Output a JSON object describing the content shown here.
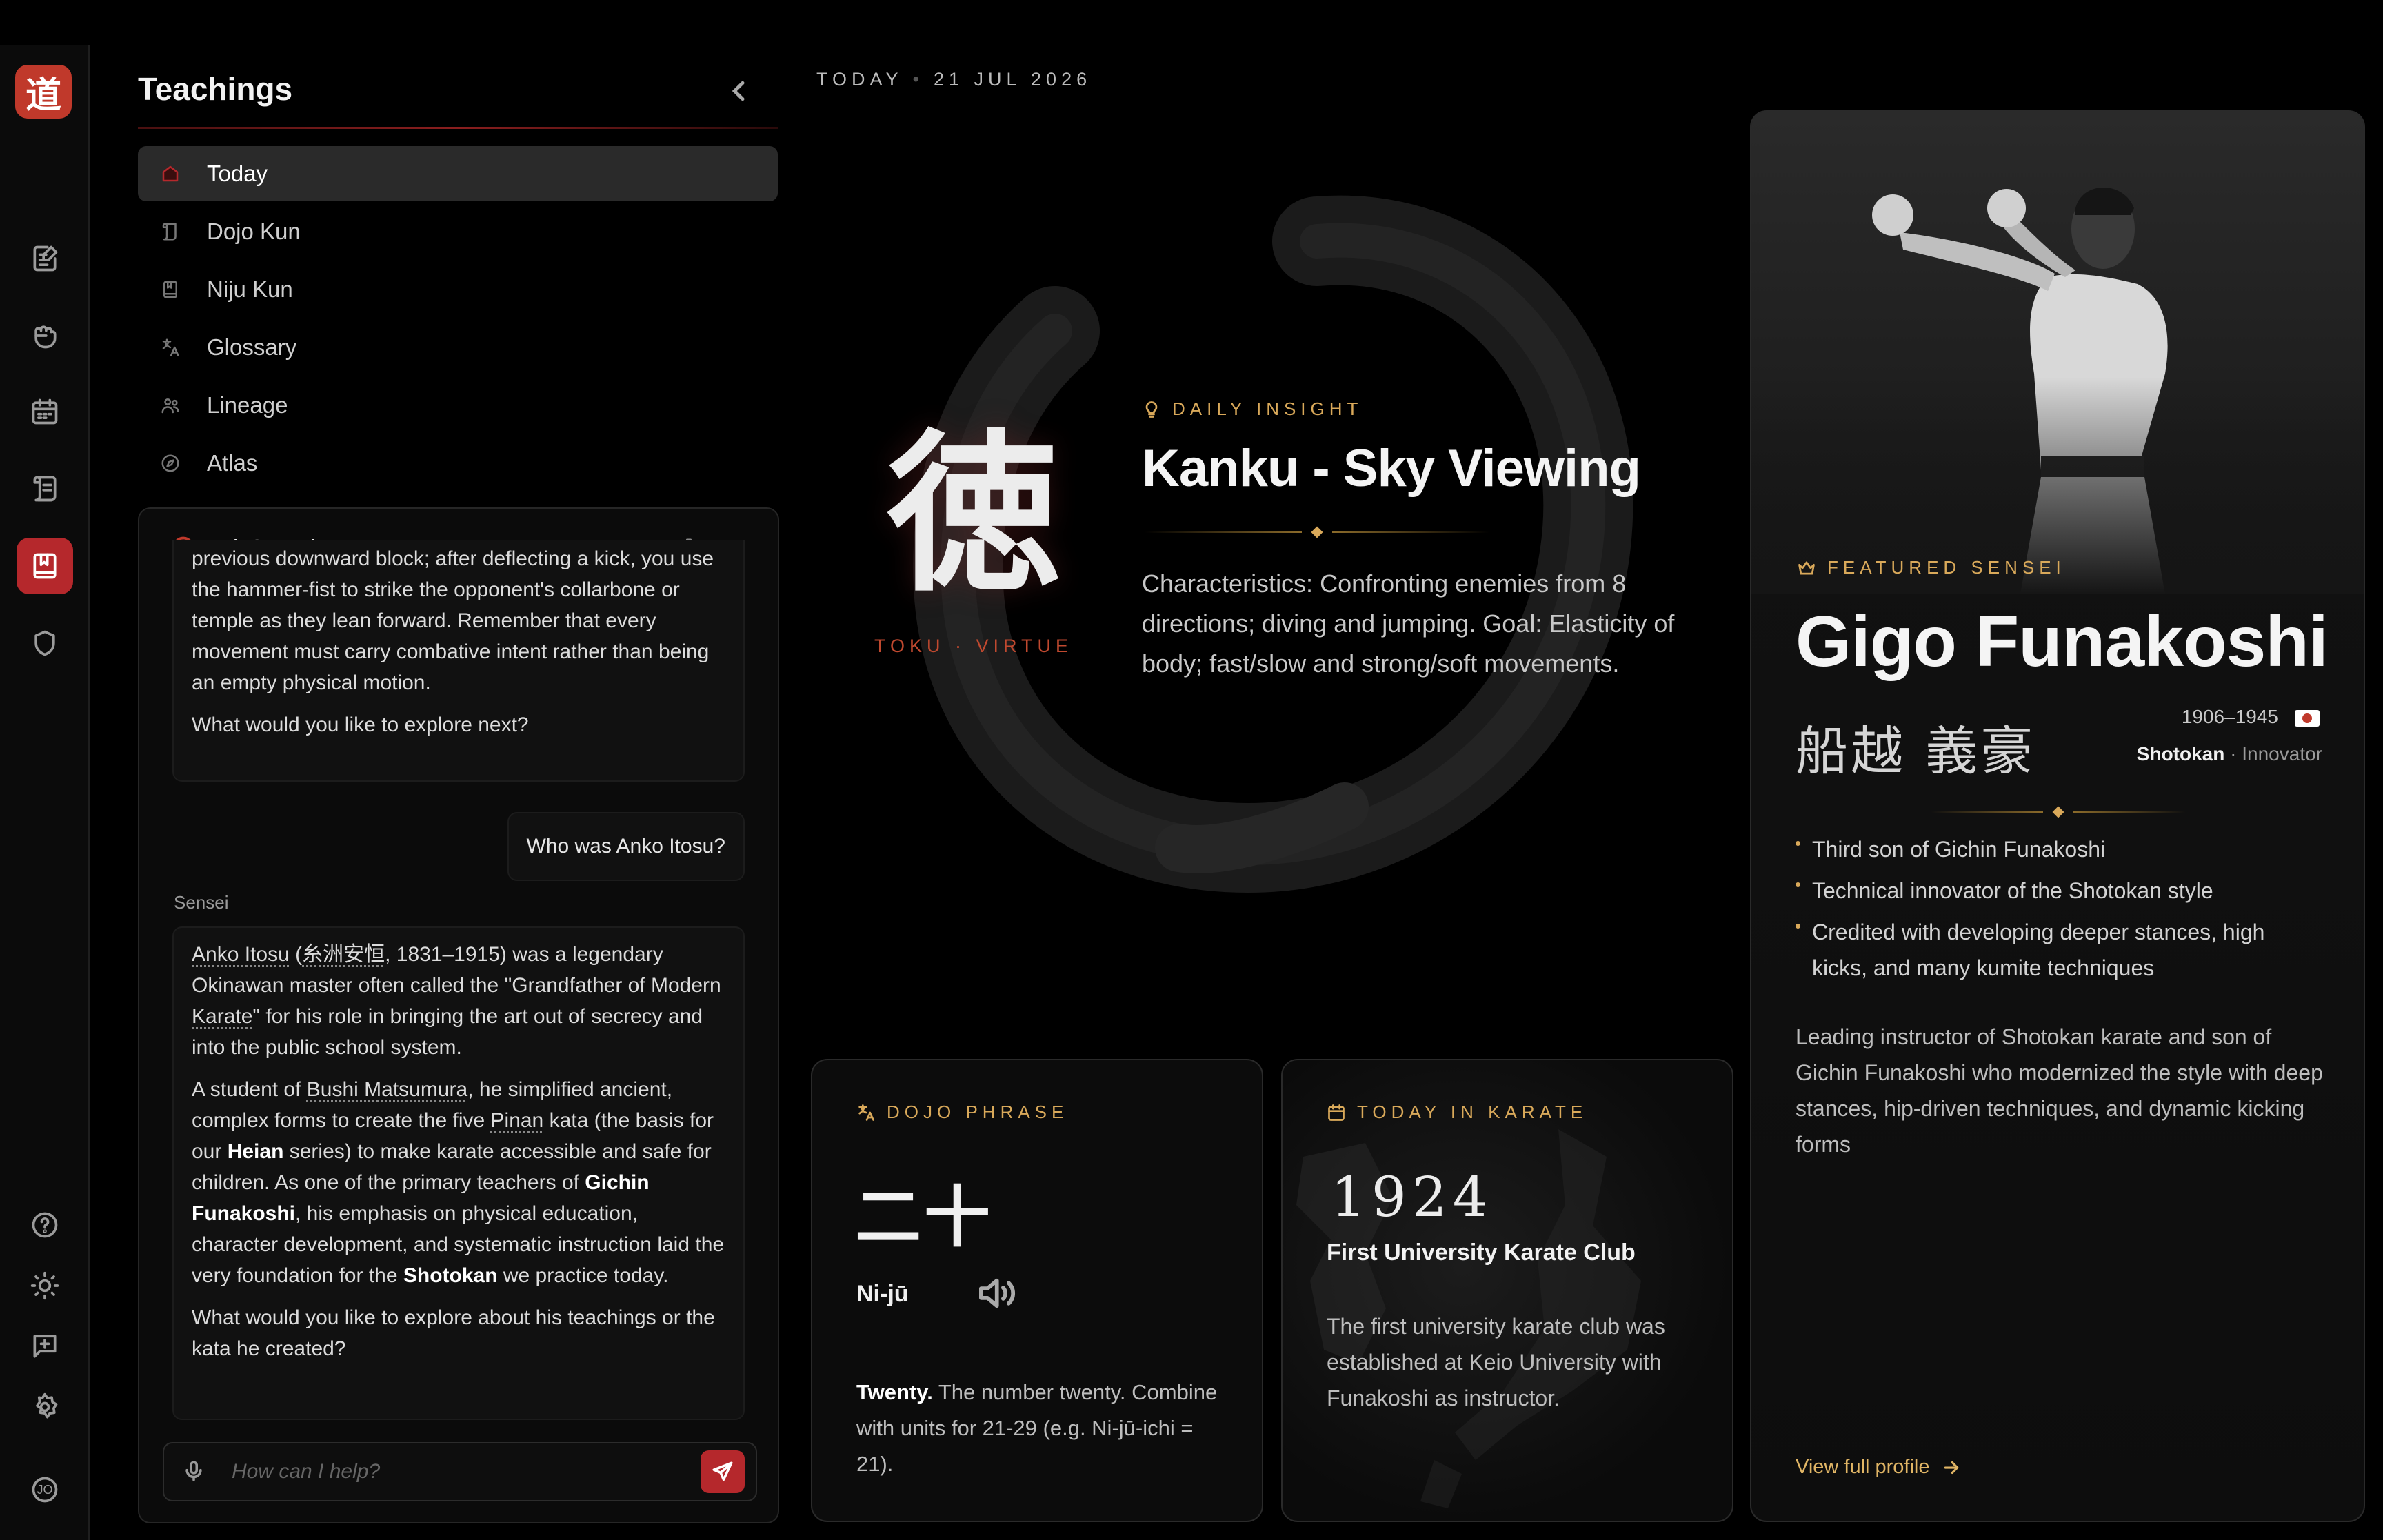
{
  "app": {
    "logo_glyph": "道",
    "accent": "#b5282c",
    "gold": "#d9a95a"
  },
  "rail": {
    "items": [
      {
        "icon": "edit-note-icon"
      },
      {
        "icon": "fist-icon"
      },
      {
        "icon": "calendar-icon"
      },
      {
        "icon": "scroll-icon"
      },
      {
        "icon": "book-icon",
        "active": true
      },
      {
        "icon": "shield-icon"
      }
    ],
    "bottom": [
      {
        "icon": "help-icon"
      },
      {
        "icon": "sun-icon"
      },
      {
        "icon": "feedback-icon"
      },
      {
        "icon": "settings-icon"
      }
    ],
    "avatar_initials": "JO"
  },
  "sidebar": {
    "title": "Teachings",
    "items": [
      {
        "label": "Today",
        "icon": "home-icon",
        "active": true
      },
      {
        "label": "Dojo Kun",
        "icon": "scroll-icon"
      },
      {
        "label": "Niju Kun",
        "icon": "book-icon"
      },
      {
        "label": "Glossary",
        "icon": "translate-icon"
      },
      {
        "label": "Lineage",
        "icon": "users-icon"
      },
      {
        "label": "Atlas",
        "icon": "compass-icon"
      }
    ]
  },
  "chat": {
    "title": "Ask Sensei",
    "prev_a": "previous downward block; after deflecting a kick, you use the hammer-fist to strike the opponent's collarbone or temple as they lean forward. Remember that every movement must carry combative intent rather than being an empty physical motion.",
    "prev_b": "What would you like to explore next?",
    "user_msg": "Who was Anko Itosu?",
    "sender": "Sensei",
    "r1_name": "Anko Itosu",
    "r1_kanji": "糸洲安恒",
    "r1_a": ", 1831–1915) was a legendary Okinawan master often called the \"Grandfather of Modern ",
    "r1_karate": "Karate",
    "r1_b": "\" for his role in bringing the art out of secrecy and into the public school system.",
    "r2_a": "A student of ",
    "r2_bushi": "Bushi Matsumura",
    "r2_b": ", he simplified ancient, complex forms to create the five ",
    "r2_pinan": "Pinan",
    "r2_c": " kata (the basis for our ",
    "r2_heian": "Heian",
    "r2_d": " series) to make karate accessible and safe for children. As one of the primary teachers of ",
    "r2_gichin": "Gichin Funakoshi",
    "r2_e": ", his emphasis on physical education, character development, and systematic instruction laid the very foundation for the ",
    "r2_shotokan": "Shotokan",
    "r2_f": " we practice today.",
    "r3": "What would you like to explore about his teachings or the kata he created?",
    "input_placeholder": "How can I help?"
  },
  "date": {
    "label": "TODAY",
    "value": "21 JUL 2026"
  },
  "hero": {
    "kanji": "徳",
    "kanji_sub": "TOKU · VIRTUE",
    "eyebrow": "DAILY INSIGHT",
    "title": "Kanku - Sky Viewing",
    "body": "Characteristics: Confronting enemies from 8 directions; diving and jumping. Goal: Elasticity of body; fast/slow and strong/soft movements."
  },
  "dojo_phrase": {
    "eyebrow": "DOJO PHRASE",
    "kanji": "二十",
    "romaji": "Ni-jū",
    "term": "Twenty.",
    "body": " The number twenty. Combine with units for 21-29 (e.g. Ni-jū-ichi = 21)."
  },
  "today_in_karate": {
    "eyebrow": "TODAY IN KARATE",
    "year": "1924",
    "title": "First University Karate Club",
    "body": "The first university karate club was established at Keio University with Funakoshi as instructor."
  },
  "featured": {
    "eyebrow": "FEATURED SENSEI",
    "name": "Gigo Funakoshi",
    "kanji": "船越 義豪",
    "years": "1906–1945",
    "style": "Shotokan",
    "role": "Innovator",
    "facts": [
      "Third son of Gichin Funakoshi",
      "Technical innovator of the Shotokan style",
      "Credited with developing deeper stances, high kicks, and many kumite techniques"
    ],
    "bio": "Leading instructor of Shotokan karate and son of Gichin Funakoshi who modernized the style with deep stances, hip-driven techniques, and dynamic kicking forms",
    "link": "View full profile"
  }
}
